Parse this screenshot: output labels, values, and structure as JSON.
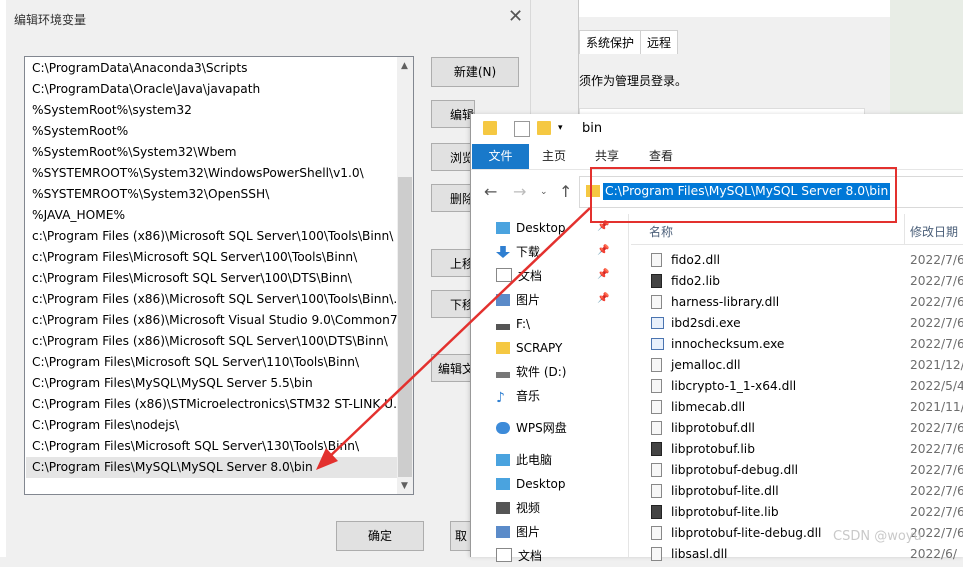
{
  "env_dialog": {
    "title": "编辑环境变量",
    "close": "✕",
    "paths": [
      "C:\\ProgramData\\Anaconda3\\Scripts",
      "C:\\ProgramData\\Oracle\\Java\\javapath",
      "%SystemRoot%\\system32",
      "%SystemRoot%",
      "%SystemRoot%\\System32\\Wbem",
      "%SYSTEMROOT%\\System32\\WindowsPowerShell\\v1.0\\",
      "%SYSTEMROOT%\\System32\\OpenSSH\\",
      "%JAVA_HOME%",
      "c:\\Program Files (x86)\\Microsoft SQL Server\\100\\Tools\\Binn\\",
      "c:\\Program Files\\Microsoft SQL Server\\100\\Tools\\Binn\\",
      "c:\\Program Files\\Microsoft SQL Server\\100\\DTS\\Binn\\",
      "c:\\Program Files (x86)\\Microsoft SQL Server\\100\\Tools\\Binn\\...",
      "c:\\Program Files (x86)\\Microsoft Visual Studio 9.0\\Common7...",
      "c:\\Program Files (x86)\\Microsoft SQL Server\\100\\DTS\\Binn\\",
      "C:\\Program Files\\Microsoft SQL Server\\110\\Tools\\Binn\\",
      "C:\\Program Files\\MySQL\\MySQL Server 5.5\\bin",
      "C:\\Program Files (x86)\\STMicroelectronics\\STM32 ST-LINK U...",
      "C:\\Program Files\\nodejs\\",
      "C:\\Program Files\\Microsoft SQL Server\\130\\Tools\\Binn\\",
      "C:\\Program Files\\MySQL\\MySQL Server 8.0\\bin"
    ],
    "buttons": [
      "新建(N)",
      "编辑(E)",
      "浏览",
      "删除",
      "上移",
      "下移",
      "编辑文"
    ],
    "ok": "确定",
    "cancel": "取"
  },
  "background_window": {
    "tabs": [
      "系统保护",
      "远程"
    ],
    "note": "须作为管理员登录。"
  },
  "explorer": {
    "quick_access_title": "bin",
    "ribbon_tabs": [
      "文件",
      "主页",
      "共享",
      "查看"
    ],
    "address_path": "C:\\Program Files\\MySQL\\MySQL Server 8.0\\bin",
    "nav_items": [
      "Desktop",
      "下载",
      "文档",
      "图片",
      "F:\\",
      "SCRAPY",
      "软件 (D:)",
      "音乐",
      "WPS网盘",
      "此电脑",
      "Desktop",
      "视频",
      "图片",
      "文档"
    ],
    "col_name": "名称",
    "col_date": "修改日期",
    "files": [
      {
        "name": "fido2.dll",
        "date": "2022/7/6"
      },
      {
        "name": "fido2.lib",
        "date": "2022/7/6"
      },
      {
        "name": "harness-library.dll",
        "date": "2022/7/6"
      },
      {
        "name": "ibd2sdi.exe",
        "date": "2022/7/6"
      },
      {
        "name": "innochecksum.exe",
        "date": "2022/7/6"
      },
      {
        "name": "jemalloc.dll",
        "date": "2021/12/"
      },
      {
        "name": "libcrypto-1_1-x64.dll",
        "date": "2022/5/4"
      },
      {
        "name": "libmecab.dll",
        "date": "2021/11/"
      },
      {
        "name": "libprotobuf.dll",
        "date": "2022/7/6"
      },
      {
        "name": "libprotobuf.lib",
        "date": "2022/7/6"
      },
      {
        "name": "libprotobuf-debug.dll",
        "date": "2022/7/6"
      },
      {
        "name": "libprotobuf-lite.dll",
        "date": "2022/7/6"
      },
      {
        "name": "libprotobuf-lite.lib",
        "date": "2022/7/6"
      },
      {
        "name": "libprotobuf-lite-debug.dll",
        "date": "2022/7/6"
      },
      {
        "name": "libsasl.dll",
        "date": "2022/6/"
      }
    ]
  },
  "watermark": "CSDN @woyu",
  "colors": {
    "accent": "#0078d7",
    "annotation": "#e3312e",
    "ribbon_file": "#1979ca"
  }
}
